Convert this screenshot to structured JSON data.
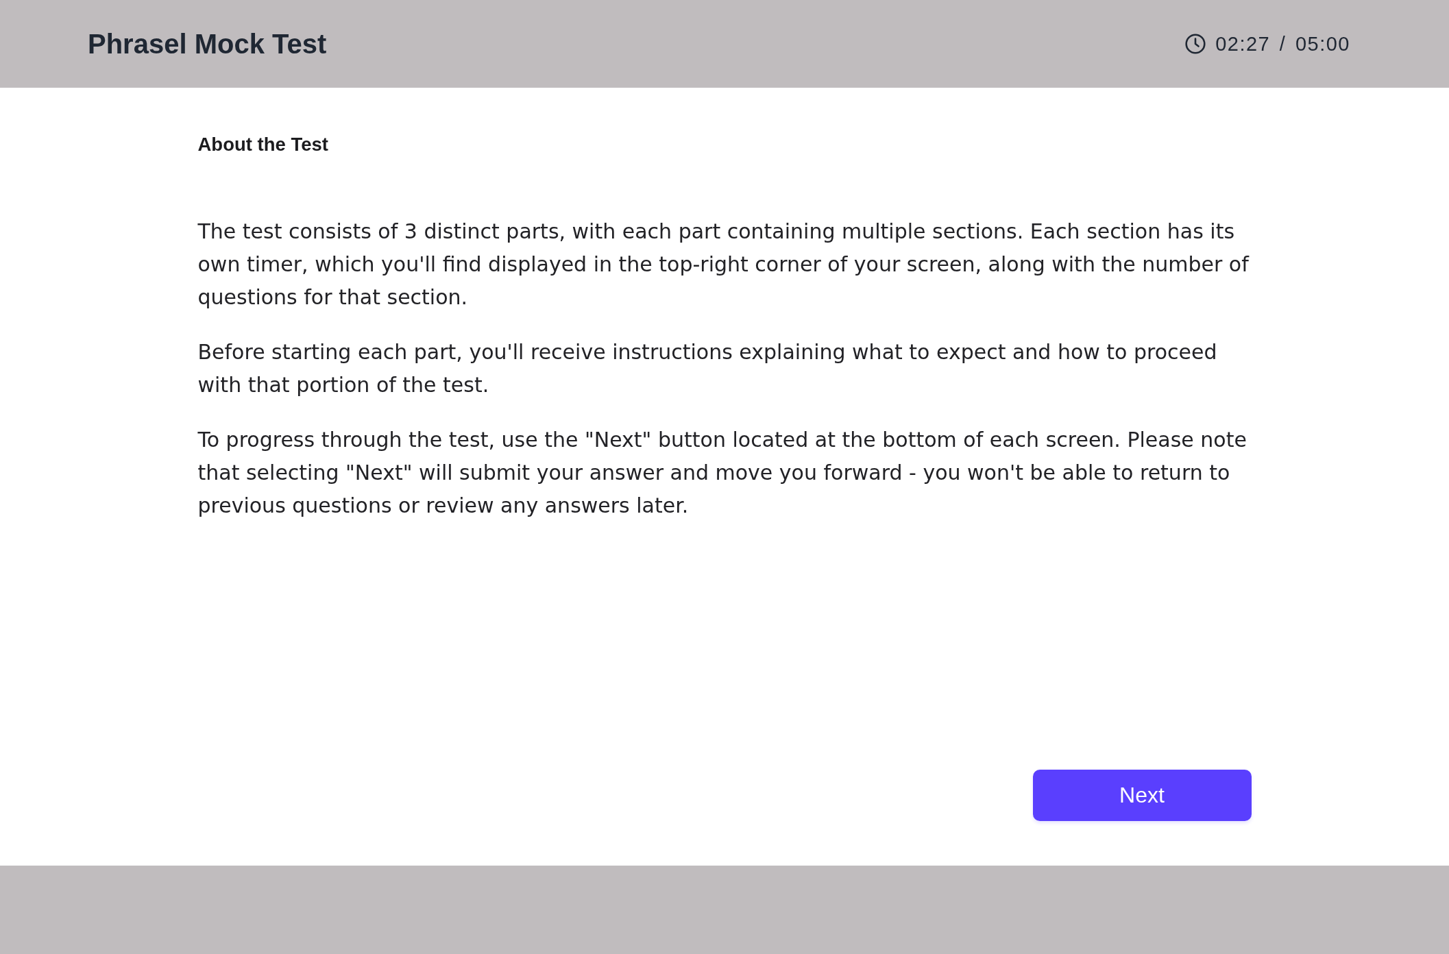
{
  "header": {
    "title": "Phrasel Mock Test",
    "timer": "02:27 / 05:00"
  },
  "content": {
    "heading": "About the Test",
    "paragraphs": [
      "The test consists of 3 distinct parts, with each part containing multiple sections. Each section has its own timer, which you'll find displayed in the top-right corner of your screen, along with the number of questions for that section.",
      "Before starting each part, you'll receive instructions explaining what to expect and how to proceed with that portion of the test.",
      "To progress through the test, use the \"Next\" button located at the bottom of each screen. Please note that selecting \"Next\" will submit your answer and move you forward - you won't be able to return to previous questions or review any answers later."
    ]
  },
  "next_button": {
    "label": "Next"
  }
}
